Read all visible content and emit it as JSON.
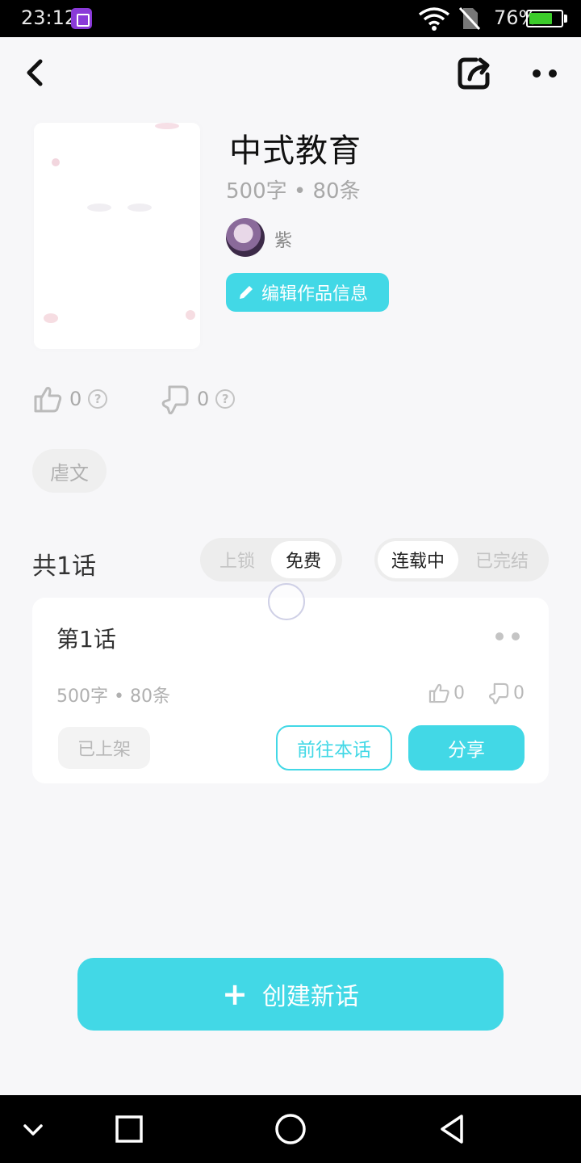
{
  "status_bar": {
    "time": "23:12",
    "battery": "76%",
    "battery_level": 0.76
  },
  "header": {
    "back_icon": "chevron-left-icon",
    "share_icon": "share-icon",
    "more_icon": "more-dots-icon"
  },
  "work": {
    "title": "中式教育",
    "meta": "500字 • 80条",
    "author": "紫",
    "edit_label": "编辑作品信息",
    "likes": "0",
    "dislikes": "0",
    "tag": "虐文"
  },
  "chapters": {
    "count_label": "共1话",
    "lock_filter": {
      "options": [
        "上锁",
        "免费"
      ],
      "selected": "免费"
    },
    "status_filter": {
      "options": [
        "连载中",
        "已完结"
      ],
      "selected": "连载中"
    },
    "items": [
      {
        "title": "第1话",
        "meta": "500字 • 80条",
        "likes": "0",
        "dislikes": "0",
        "status": "已上架",
        "goto_label": "前往本话",
        "share_label": "分享"
      }
    ]
  },
  "create_label": "创建新话",
  "colors": {
    "accent": "#42d8e6",
    "background": "#f7f7f9"
  }
}
